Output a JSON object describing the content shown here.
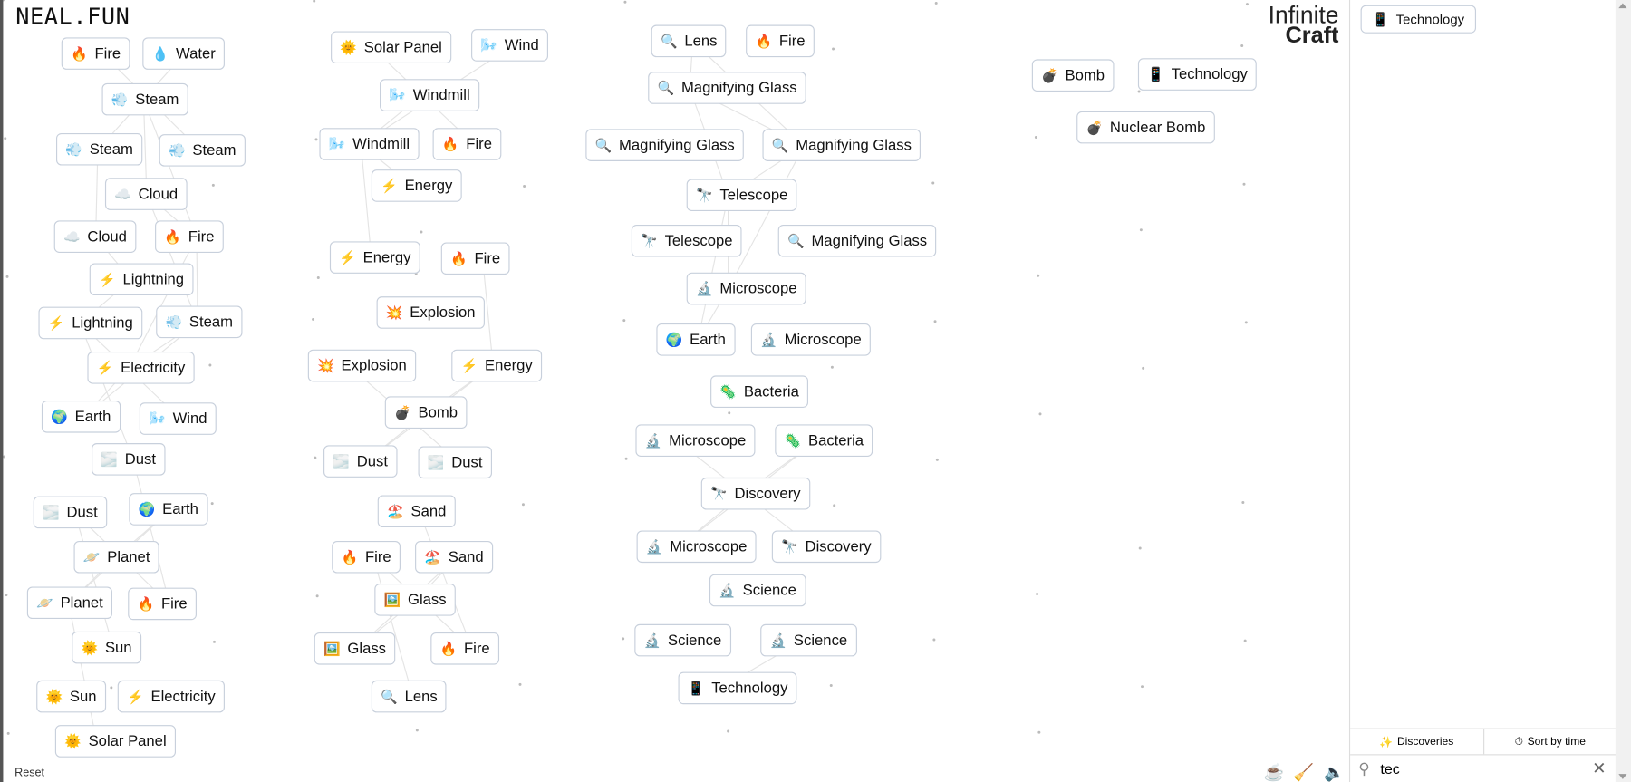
{
  "header": {
    "logo": "NEAL.FUN",
    "title_line1": "Infinite",
    "title_line2": "Craft"
  },
  "toolbar": {
    "reset": "Reset",
    "icons": [
      "coffee-icon",
      "broom-icon",
      "speaker-icon"
    ]
  },
  "canvas_items": [
    {
      "icon": "🔥",
      "name": "fire",
      "label": "Fire"
    },
    {
      "icon": "💧",
      "name": "water",
      "label": "Water"
    },
    {
      "icon": "🌞",
      "name": "sun",
      "label": "Solar Panel"
    },
    {
      "icon": "🌬️",
      "name": "wind",
      "label": "Wind"
    },
    {
      "icon": "🔍",
      "name": "magnifier",
      "label": "Lens"
    },
    {
      "icon": "🔥",
      "name": "fire",
      "label": "Fire"
    },
    {
      "icon": "💨",
      "name": "steam",
      "label": "Steam"
    },
    {
      "icon": "🌬️",
      "name": "wind",
      "label": "Windmill"
    },
    {
      "icon": "🔍",
      "name": "magnifier",
      "label": "Magnifying Glass"
    },
    {
      "icon": "💣",
      "name": "bomb",
      "label": "Bomb"
    },
    {
      "icon": "📱",
      "name": "phone",
      "label": "Technology"
    },
    {
      "icon": "💨",
      "name": "steam",
      "label": "Steam"
    },
    {
      "icon": "💨",
      "name": "steam",
      "label": "Steam"
    },
    {
      "icon": "🌬️",
      "name": "wind",
      "label": "Windmill"
    },
    {
      "icon": "🔥",
      "name": "fire",
      "label": "Fire"
    },
    {
      "icon": "🔍",
      "name": "magnifier",
      "label": "Magnifying Glass"
    },
    {
      "icon": "🔍",
      "name": "magnifier",
      "label": "Magnifying Glass"
    },
    {
      "icon": "💣",
      "name": "bomb",
      "label": "Nuclear Bomb"
    },
    {
      "icon": "☁️",
      "name": "cloud",
      "label": "Cloud"
    },
    {
      "icon": "⚡",
      "name": "lightning",
      "label": "Energy"
    },
    {
      "icon": "🔭",
      "name": "telescope",
      "label": "Telescope"
    },
    {
      "icon": "☁️",
      "name": "cloud",
      "label": "Cloud"
    },
    {
      "icon": "🔥",
      "name": "fire",
      "label": "Fire"
    },
    {
      "icon": "⚡",
      "name": "lightning",
      "label": "Energy"
    },
    {
      "icon": "🔥",
      "name": "fire",
      "label": "Fire"
    },
    {
      "icon": "🔭",
      "name": "telescope",
      "label": "Telescope"
    },
    {
      "icon": "🔍",
      "name": "magnifier",
      "label": "Magnifying Glass"
    },
    {
      "icon": "⚡",
      "name": "lightning",
      "label": "Lightning"
    },
    {
      "icon": "🔬",
      "name": "microscope",
      "label": "Microscope"
    },
    {
      "icon": "⚡",
      "name": "lightning",
      "label": "Lightning"
    },
    {
      "icon": "💨",
      "name": "steam",
      "label": "Steam"
    },
    {
      "icon": "💥",
      "name": "explosion",
      "label": "Explosion"
    },
    {
      "icon": "🌍",
      "name": "globe",
      "label": "Earth"
    },
    {
      "icon": "🔬",
      "name": "microscope",
      "label": "Microscope"
    },
    {
      "icon": "⚡",
      "name": "lightning",
      "label": "Electricity"
    },
    {
      "icon": "💥",
      "name": "explosion",
      "label": "Explosion"
    },
    {
      "icon": "⚡",
      "name": "lightning",
      "label": "Energy"
    },
    {
      "icon": "🦠",
      "name": "microbe",
      "label": "Bacteria"
    },
    {
      "icon": "🌍",
      "name": "globe",
      "label": "Earth"
    },
    {
      "icon": "🌬️",
      "name": "wind",
      "label": "Wind"
    },
    {
      "icon": "💣",
      "name": "bomb",
      "label": "Bomb"
    },
    {
      "icon": "🔬",
      "name": "microscope",
      "label": "Microscope"
    },
    {
      "icon": "🦠",
      "name": "microbe",
      "label": "Bacteria"
    },
    {
      "icon": "🌫️",
      "name": "dust",
      "label": "Dust"
    },
    {
      "icon": "🌫️",
      "name": "dust",
      "label": "Dust"
    },
    {
      "icon": "🌫️",
      "name": "dust",
      "label": "Dust"
    },
    {
      "icon": "🔭",
      "name": "telescope",
      "label": "Discovery"
    },
    {
      "icon": "🌫️",
      "name": "dust",
      "label": "Dust"
    },
    {
      "icon": "🌍",
      "name": "globe",
      "label": "Earth"
    },
    {
      "icon": "🏖️",
      "name": "beach",
      "label": "Sand"
    },
    {
      "icon": "🔬",
      "name": "microscope",
      "label": "Microscope"
    },
    {
      "icon": "🔭",
      "name": "telescope",
      "label": "Discovery"
    },
    {
      "icon": "🪐",
      "name": "planet",
      "label": "Planet"
    },
    {
      "icon": "🔥",
      "name": "fire",
      "label": "Fire"
    },
    {
      "icon": "🏖️",
      "name": "beach",
      "label": "Sand"
    },
    {
      "icon": "🔬",
      "name": "microscope",
      "label": "Science"
    },
    {
      "icon": "🪐",
      "name": "planet",
      "label": "Planet"
    },
    {
      "icon": "🔥",
      "name": "fire",
      "label": "Fire"
    },
    {
      "icon": "🖼️",
      "name": "picture",
      "label": "Glass"
    },
    {
      "icon": "🔬",
      "name": "microscope",
      "label": "Science"
    },
    {
      "icon": "🔬",
      "name": "microscope",
      "label": "Science"
    },
    {
      "icon": "🌞",
      "name": "sun",
      "label": "Sun"
    },
    {
      "icon": "🖼️",
      "name": "picture",
      "label": "Glass"
    },
    {
      "icon": "🔥",
      "name": "fire",
      "label": "Fire"
    },
    {
      "icon": "📱",
      "name": "phone",
      "label": "Technology"
    },
    {
      "icon": "🌞",
      "name": "sun",
      "label": "Sun"
    },
    {
      "icon": "⚡",
      "name": "lightning",
      "label": "Electricity"
    },
    {
      "icon": "🔍",
      "name": "magnifier",
      "label": "Lens"
    },
    {
      "icon": "🌞",
      "name": "sun",
      "label": "Solar Panel"
    }
  ],
  "sidebar": {
    "items": [
      {
        "icon": "📱",
        "label": "Technology"
      }
    ],
    "tab_discoveries": "Discoveries",
    "tab_sort": "Sort by time",
    "search_value": "tec"
  }
}
